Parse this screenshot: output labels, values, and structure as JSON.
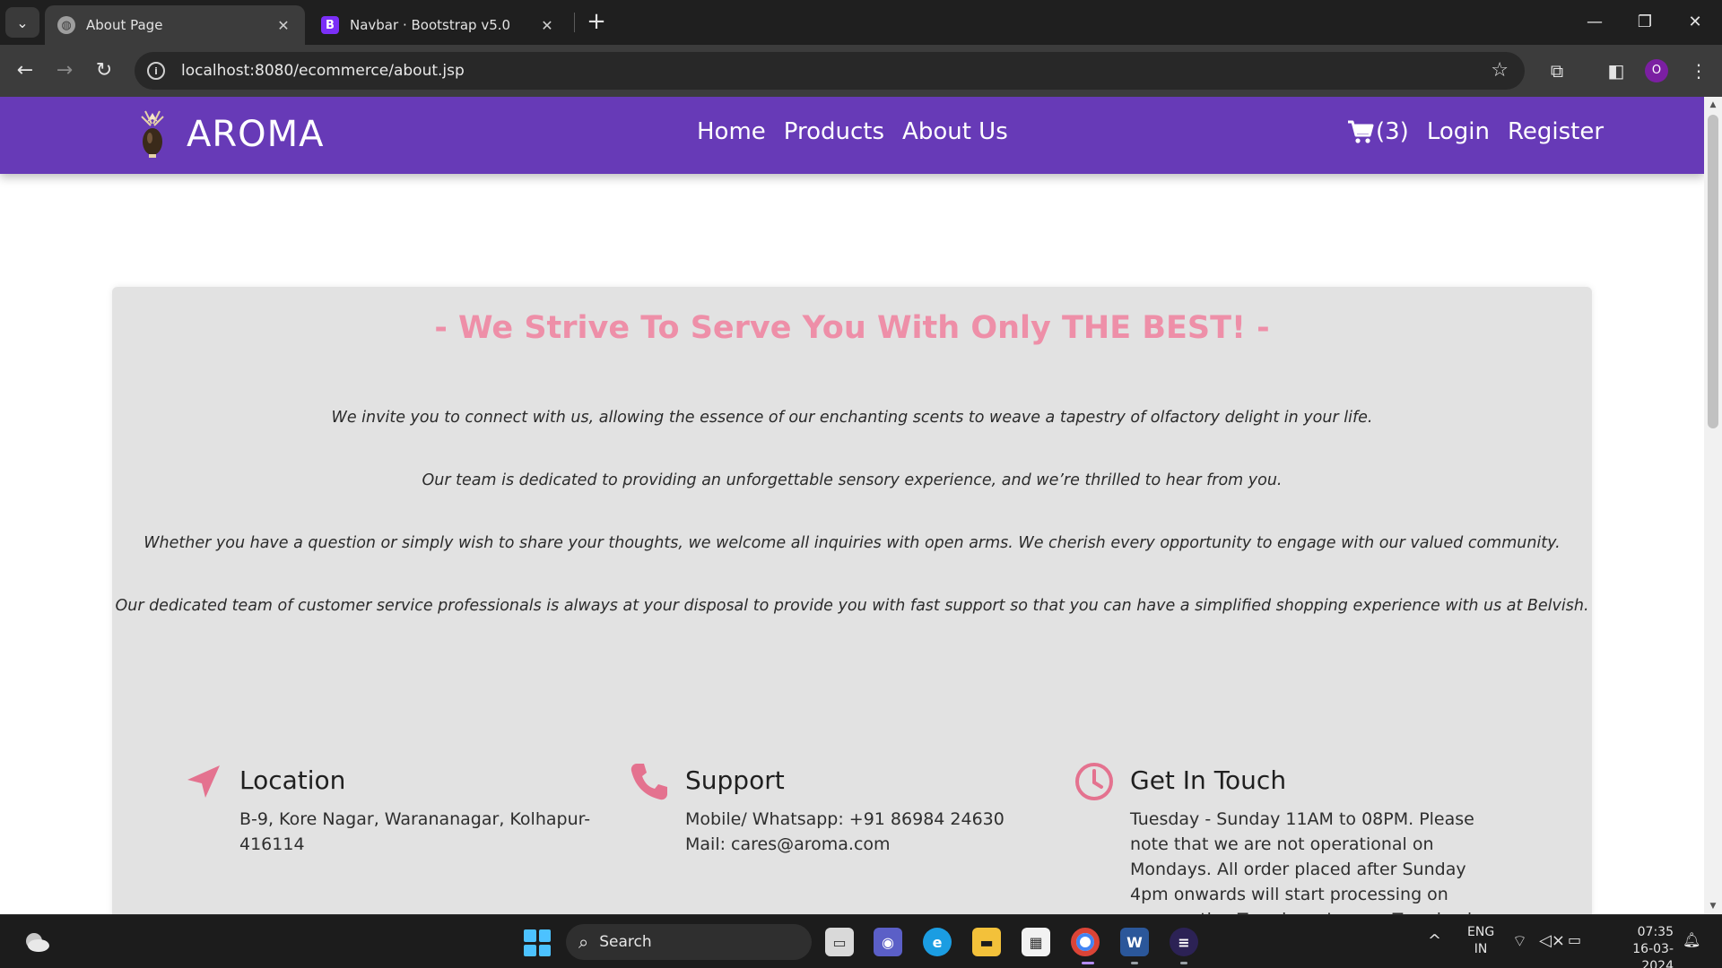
{
  "browser": {
    "tabs": [
      {
        "title": "About Page",
        "favicon": "globe-icon",
        "active": true
      },
      {
        "title": "Navbar · Bootstrap v5.0",
        "favicon": "B",
        "active": false
      }
    ],
    "url": "localhost:8080/ecommerce/about.jsp",
    "profile_initial": "O"
  },
  "site": {
    "brand": "AROMA",
    "nav": [
      "Home",
      "Products",
      "About Us"
    ],
    "cart_count": "(3)",
    "login": "Login",
    "register": "Register",
    "colors": {
      "navbar": "#673ab7",
      "accent": "#ee8fa8",
      "card": "#e2e2e2"
    }
  },
  "about": {
    "heading": "- We Strive To Serve You With Only THE BEST! -",
    "paragraphs": [
      "We invite you to connect with us, allowing the essence of our enchanting scents to weave a tapestry of olfactory delight in your life.",
      "Our team is dedicated to providing an unforgettable sensory experience, and we’re thrilled to hear from you.",
      "Whether you have a question or simply wish to share your thoughts, we welcome all inquiries with open arms. We cherish every opportunity to engage with our valued community.",
      "Our dedicated team of customer service professionals is always at your disposal to provide you with fast support so that you can have a simplified shopping experience with us at Belvish."
    ],
    "location": {
      "title": "Location",
      "icon": "location-arrow-icon",
      "address": "B-9, Kore Nagar, Warananagar, Kolhapur-416114"
    },
    "support": {
      "title": "Support",
      "icon": "phone-icon",
      "mobile": "Mobile/ Whatsapp: +91 86984 24630",
      "mail": "Mail: cares@aroma.com"
    },
    "contact": {
      "title": "Get In Touch",
      "icon": "clock-icon",
      "text": "Tuesday - Sunday 11AM to 08PM. Please note that we are not operational on Mondays. All order placed after Sunday 4pm onwards will start processing on consecutive Tuesdays. In case Tuesday is a public holiday then the"
    }
  },
  "taskbar": {
    "search": "Search",
    "lang_line1": "ENG",
    "lang_line2": "IN",
    "time": "07:35",
    "date": "16-03-2024"
  }
}
